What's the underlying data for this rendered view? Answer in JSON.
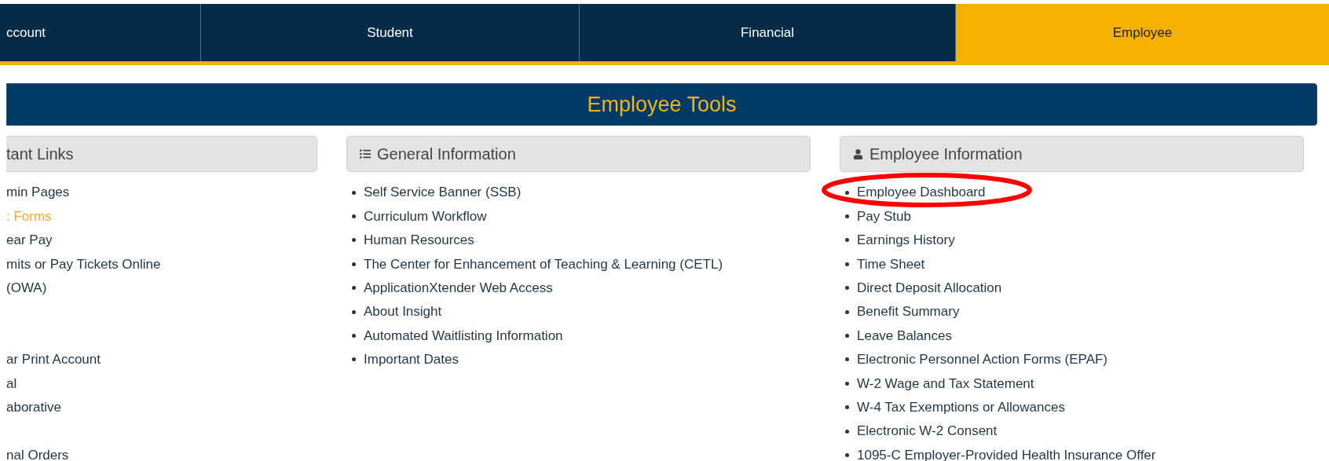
{
  "nav_tabs": [
    {
      "label": "ccount",
      "selected": false
    },
    {
      "label": "Student",
      "selected": false
    },
    {
      "label": "Financial",
      "selected": false
    },
    {
      "label": "Employee",
      "selected": true
    }
  ],
  "section_title": "Employee Tools",
  "columns": [
    {
      "kind": "partial",
      "title": "tant Links",
      "groups": [
        [
          {
            "text": "min Pages",
            "hovered": false
          },
          {
            "text": ": Forms",
            "hovered": true
          },
          {
            "text": "ear Pay",
            "hovered": false
          },
          {
            "text": "mits or Pay Tickets Online",
            "hovered": false
          },
          {
            "text": "(OWA)",
            "hovered": false
          }
        ],
        [
          {
            "text": "ar Print Account",
            "hovered": false
          },
          {
            "text": "al",
            "hovered": false
          },
          {
            "text": "aborative",
            "hovered": false
          }
        ],
        [
          {
            "text": "nal Orders",
            "hovered": false
          }
        ]
      ]
    },
    {
      "kind": "list",
      "title": "General Information",
      "groups": [
        [
          {
            "text": "Self Service Banner (SSB)",
            "hovered": false
          },
          {
            "text": "Curriculum Workflow",
            "hovered": false
          },
          {
            "text": "Human Resources",
            "hovered": false
          },
          {
            "text": "The Center for Enhancement of Teaching & Learning (CETL)",
            "hovered": false
          },
          {
            "text": "ApplicationXtender Web Access",
            "hovered": false
          },
          {
            "text": "About Insight",
            "hovered": false
          },
          {
            "text": "Automated Waitlisting Information",
            "hovered": false
          },
          {
            "text": "Important Dates",
            "hovered": false
          }
        ]
      ]
    },
    {
      "kind": "user",
      "title": "Employee Information",
      "groups": [
        [
          {
            "text": "Employee Dashboard",
            "hovered": false,
            "circled": true
          },
          {
            "text": "Pay Stub",
            "hovered": false
          },
          {
            "text": "Earnings History",
            "hovered": false
          },
          {
            "text": "Time Sheet",
            "hovered": false
          },
          {
            "text": "Direct Deposit Allocation",
            "hovered": false
          },
          {
            "text": "Benefit Summary",
            "hovered": false
          },
          {
            "text": "Leave Balances",
            "hovered": false
          },
          {
            "text": "Electronic Personnel Action Forms (EPAF)",
            "hovered": false
          },
          {
            "text": "W-2 Wage and Tax Statement",
            "hovered": false
          },
          {
            "text": "W-4 Tax Exemptions or Allowances",
            "hovered": false
          },
          {
            "text": "Electronic W-2 Consent",
            "hovered": false
          },
          {
            "text": "1095-C Employer-Provided Health Insurance Offer",
            "hovered": false
          }
        ]
      ]
    }
  ]
}
